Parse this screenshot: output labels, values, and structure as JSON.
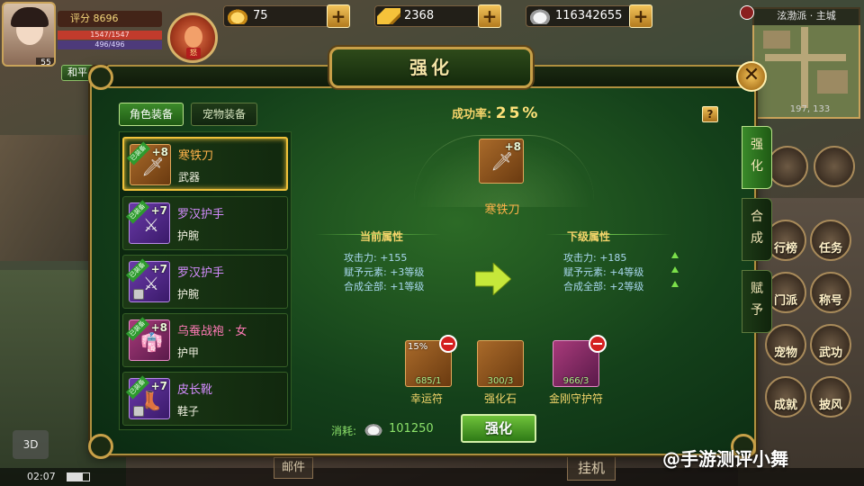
{
  "player": {
    "score_label": "评分",
    "score": "8696",
    "hp": "1547/1547",
    "mp": "496/496",
    "level": "55",
    "pet_tag": "怒",
    "pk_mode": "和平"
  },
  "resources": [
    {
      "icon": "gold-ingot-icon",
      "value": "75"
    },
    {
      "icon": "gold-bar-icon",
      "value": "2368"
    },
    {
      "icon": "silver-ingot-icon",
      "value": "116342655"
    }
  ],
  "minimap": {
    "title": "泫渤派 · 主城",
    "coords": "197, 133"
  },
  "side_menu": [
    "行榜",
    "任务",
    "门派",
    "称号",
    "宠物",
    "武功",
    "成就",
    "披风"
  ],
  "dialog": {
    "title": "强化",
    "tabs": [
      "角色装备",
      "宠物装备"
    ],
    "side_tabs": [
      "强化",
      "合成",
      "赋予"
    ],
    "success_label": "成功率:",
    "success_value": "25%",
    "help": "?",
    "equipped_badge": "已装备",
    "items": [
      {
        "name": "寒铁刀",
        "type": "武器",
        "plus": "+8",
        "quality": "orange",
        "locked": false,
        "glyph": "🗡"
      },
      {
        "name": "罗汉护手",
        "type": "护腕",
        "plus": "+7",
        "quality": "purple",
        "locked": false,
        "glyph": "⚔"
      },
      {
        "name": "罗汉护手",
        "type": "护腕",
        "plus": "+7",
        "quality": "purple",
        "locked": true,
        "glyph": "⚔"
      },
      {
        "name": "乌蚕战袍 · 女",
        "type": "护甲",
        "plus": "+8",
        "quality": "pink",
        "locked": false,
        "glyph": "👘"
      },
      {
        "name": "皮长靴",
        "type": "鞋子",
        "plus": "+7",
        "quality": "purple",
        "locked": true,
        "glyph": "👢"
      }
    ],
    "target": {
      "name": "寒铁刀",
      "plus": "+8"
    },
    "current": {
      "title": "当前属性",
      "stats": [
        "攻击力: +155",
        "赋予元素: +3等级",
        "合成全部: +1等级"
      ]
    },
    "next": {
      "title": "下级属性",
      "stats": [
        "攻击力: +185",
        "赋予元素: +4等级",
        "合成全部: +2等级"
      ]
    },
    "materials": [
      {
        "label": "幸运符",
        "count": "685/1",
        "pct": "15%",
        "removable": true
      },
      {
        "label": "强化石",
        "count": "300/3",
        "pct": "",
        "removable": false
      },
      {
        "label": "金刚守护符",
        "count": "966/3",
        "pct": "",
        "removable": true
      }
    ],
    "cost_label": "消耗:",
    "cost_value": "101250",
    "enhance_label": "强化"
  },
  "bottom": {
    "time": "02:07",
    "mail": "邮件",
    "hangup": "挂机",
    "cam": "3D",
    "watermark": "@手游测评小舞"
  },
  "colors": {
    "accent_gold": "#f5d46a",
    "panel_green": "#14401a",
    "orange": "#ffb24a",
    "purple": "#d48cff",
    "pink": "#ff7ab6"
  }
}
